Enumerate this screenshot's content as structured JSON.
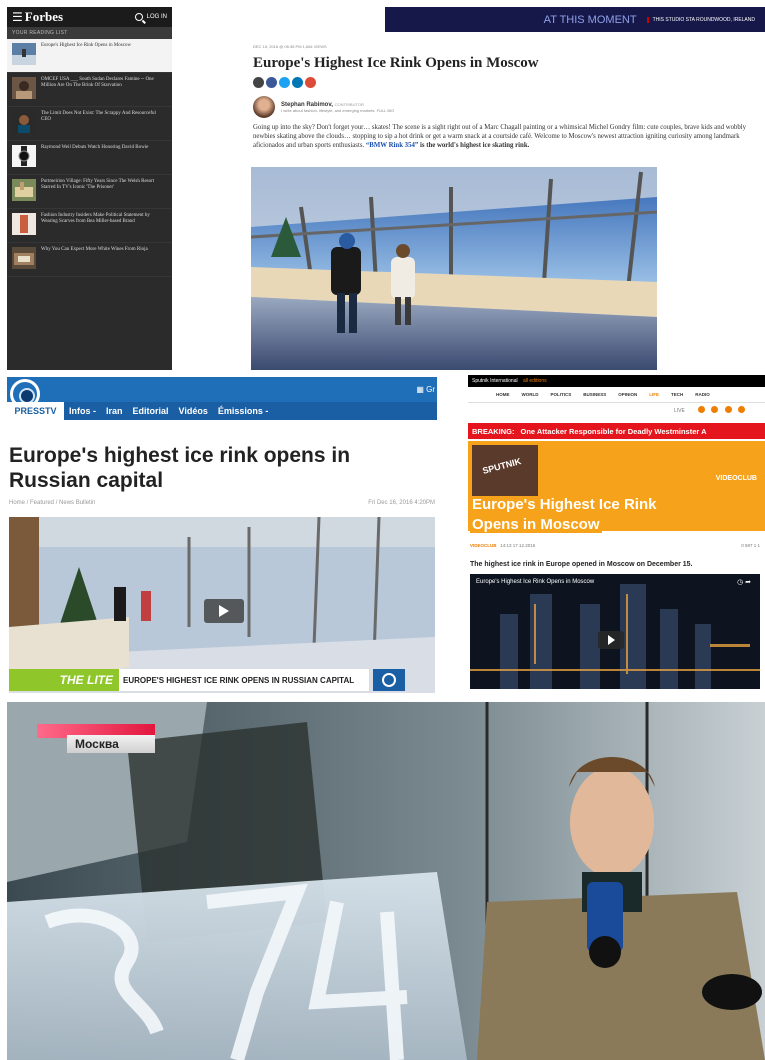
{
  "forbes": {
    "logo": "Forbes",
    "login": "LOG IN",
    "reading_list": "YOUR READING LIST",
    "sidebar": [
      {
        "tag": "",
        "text": "Europe's Highest Ice Rink Opens in Moscow"
      },
      {
        "tag": "",
        "text": "OMCEF USA ___ South Sudan Declares Famine -- One Million Are On The Brink Of Starvation"
      },
      {
        "tag": "",
        "text": "The Limit Does Not Exist: The Scrappy And Resourceful CEO"
      },
      {
        "tag": "",
        "text": "Raymond Weil Debuts Watch Honoring David Bowie"
      },
      {
        "tag": "",
        "text": "Portmeirion Village: Fifty Years Since The Welsh Resort Starred In TV's Iconic 'The Prisoner'"
      },
      {
        "tag": "",
        "text": "Fashion Industry Insiders Make Political Statement by Wearing Scarves from Bea Miller-based Brand"
      },
      {
        "tag": "",
        "text": "Why You Can Expect More White Wines From Rioja"
      }
    ],
    "banner_text": "AT THIS MOMENT",
    "banner_right": "THIS STUDIO STA ROUNDWOOD, IRELAND",
    "meta": "DEC 15, 2016 @ 06:36 PM     1,684 VIEWS",
    "title": "Europe's Highest Ice Rink Opens in Moscow",
    "author_name": "Stephan Rabimov,",
    "author_role": "CONTRIBUTOR",
    "author_desc": "I write about fashion, lifestyle, and emerging markets.  FULL BIO",
    "body_1": "Going up into the sky? Don't forget your… skates! The scene is a sight right out of a Marc Chagall painting or a whimsical Michel Gondry film: cute couples, brave kids and wobbly newbies skating above the clouds… stopping to sip a hot drink or get a warm snack at a courtside café. Welcome to Moscow's newest attraction igniting curiosity among landmark aficionados and urban sports enthusiasts. ",
    "body_link": "“BMW Rink 354”",
    "body_2": " is the world's highest ice skating rink."
  },
  "presstv": {
    "brand": "PRESSTV",
    "nav": [
      "Infos -",
      "Iran",
      "Editorial",
      "Vidéos",
      "Émissions -"
    ],
    "grid_label": "Gr",
    "title": "Europe's highest ice rink opens in Russian capital",
    "breadcrumbs": "Home / Featured / News Bulletin",
    "date": "Fri Dec 16, 2016 4:20PM",
    "lower_tag": "THE LITE",
    "lower_headline": "EUROPE'S HIGHEST ICE RINK OPENS IN RUSSIAN CAPITAL"
  },
  "sputnik": {
    "top_label": "Sputnik International",
    "top_lang": "all editions",
    "nav": [
      "HOME",
      "WORLD",
      "POLITICS",
      "BUSINESS",
      "OPINION",
      "LIFE",
      "TECH",
      "RADIO"
    ],
    "live": "LIVE",
    "breaking_label": "BREAKING:",
    "breaking_text": "One Attacker Responsible for Deadly Westminster A",
    "logo": "SPUTNIK",
    "videoclub": "VIDEOCLUB",
    "title_line1": "Europe's Highest Ice Rink",
    "title_line2": "Opens in Moscow",
    "meta_cat": "VIDEOCLUB",
    "meta_date": "14:13 17.12.2016",
    "meta_counts": "0  597  1  1",
    "lead": "The highest ice rink in Europe opened in Moscow on December 15.",
    "video_title": "Europe's Highest Ice Rink Opens in Moscow"
  },
  "tv": {
    "location": "Москва",
    "rink_number": "354"
  }
}
